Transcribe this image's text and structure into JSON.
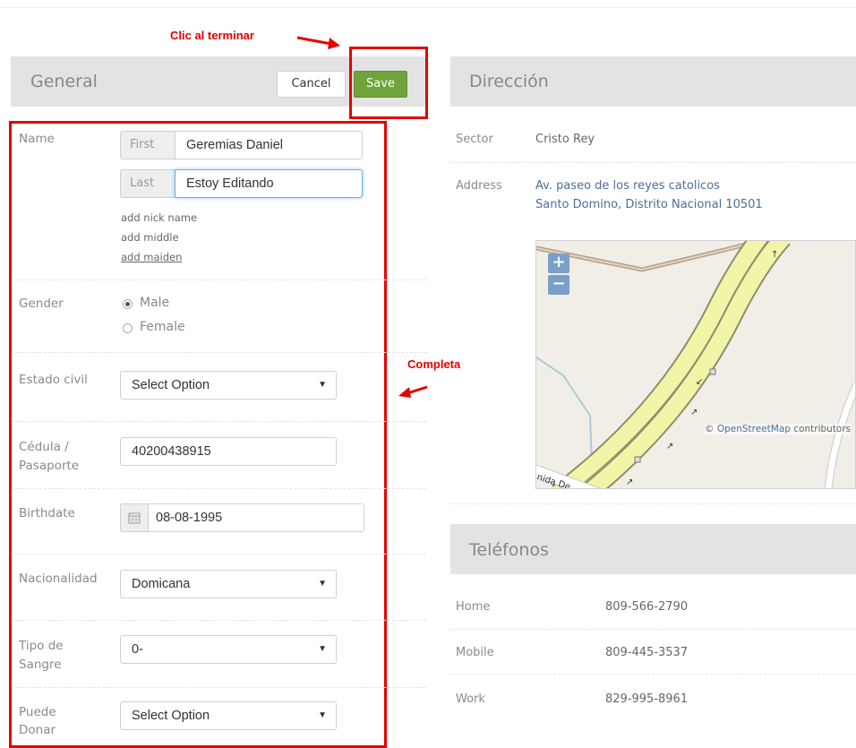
{
  "annotations": {
    "clic_terminar": "Clic al terminar",
    "completa": "Completa"
  },
  "general": {
    "title": "General",
    "cancel_label": "Cancel",
    "save_label": "Save",
    "name": {
      "label": "Name",
      "first_addon": "First",
      "first_value": "Geremias Daniel",
      "last_addon": "Last",
      "last_value": "Estoy Editando",
      "add_nick": "add nick name",
      "add_middle": "add middle",
      "add_maiden": "add maiden"
    },
    "gender": {
      "label": "Gender",
      "options": [
        "Male",
        "Female"
      ],
      "selected": "Male"
    },
    "estado_civil": {
      "label": "Estado civil",
      "value": "Select Option"
    },
    "cedula": {
      "label_line1": "Cédula /",
      "label_line2": "Pasaporte",
      "value": "40200438915"
    },
    "birthdate": {
      "label": "Birthdate",
      "value": "08-08-1995"
    },
    "nacionalidad": {
      "label": "Nacionalidad",
      "value": "Domicana"
    },
    "tipo_sangre": {
      "label_line1": "Tipo de",
      "label_line2": "Sangre",
      "value": "0-"
    },
    "puede_donar": {
      "label_line1": "Puede",
      "label_line2": "Donar",
      "value": "Select Option"
    }
  },
  "direccion": {
    "title": "Dirección",
    "sector_label": "Sector",
    "sector_value": "Cristo Rey",
    "address_label": "Address",
    "address_line1": "Av. paseo de los reyes catolicos",
    "address_line2": "Santo Domino, Distrito Nacional 10501",
    "map": {
      "zoom_in": "+",
      "zoom_out": "−",
      "attribution_symbol": "©",
      "attribution_link": "OpenStreetMap",
      "attribution_rest": "contributors",
      "street_label": "nida De"
    }
  },
  "telefonos": {
    "title": "Teléfonos",
    "rows": [
      {
        "label": "Home",
        "value": "809-566-2790"
      },
      {
        "label": "Mobile",
        "value": "809-445-3537"
      },
      {
        "label": "Work",
        "value": "829-995-8961"
      }
    ]
  },
  "colors": {
    "annotation_red": "#e60000",
    "save_green": "#6ea43b",
    "header_gray": "#e3e3e3"
  }
}
